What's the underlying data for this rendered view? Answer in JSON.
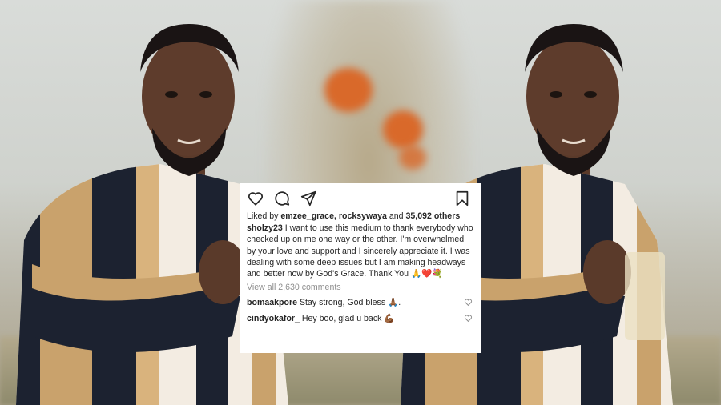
{
  "post": {
    "likes": {
      "prefix": "Liked by ",
      "users": "emzee_grace, rocksywaya",
      "middle": " and ",
      "count": "35,092 others"
    },
    "caption": {
      "username": "sholzy23",
      "text": " I want to use this medium to thank everybody who checked up on me one way or the other. I'm overwhelmed by your love and support and I sincerely appreciate it. I was dealing with some deep issues but I am making headways and better now by God's Grace. Thank You 🙏❤️💐"
    },
    "view_all": "View all 2,630 comments",
    "comments": [
      {
        "username": "bomaakpore",
        "text": " Stay strong, God bless 🙏🏾."
      },
      {
        "username": "cindyokafor_",
        "text": " Hey boo, glad u back 💪🏾"
      }
    ],
    "icons": [
      "heart-icon",
      "comment-icon",
      "share-icon",
      "bookmark-icon"
    ]
  }
}
